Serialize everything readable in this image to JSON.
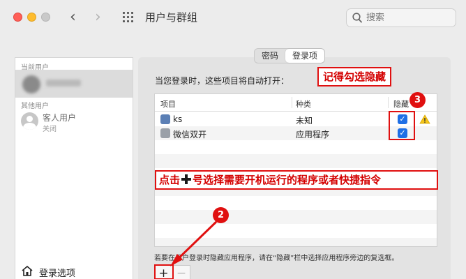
{
  "window": {
    "title": "用户与群组",
    "search_placeholder": "搜索"
  },
  "sidebar": {
    "current_user_section": "当前用户",
    "other_users_section": "其他用户",
    "guest": {
      "name": "客人用户",
      "status": "关闭"
    },
    "login_options": "登录选项"
  },
  "tabs": [
    {
      "label": "密码",
      "active": false
    },
    {
      "label": "登录项",
      "active": true
    }
  ],
  "login_items": {
    "instruction": "当您登录时，这些项目将自动打开：",
    "columns": {
      "item": "项目",
      "kind": "种类",
      "hide": "隐藏"
    },
    "rows": [
      {
        "name": "ks",
        "kind": "未知",
        "hidden": true,
        "icon": "app-icon-ks"
      },
      {
        "name": "微信双开",
        "kind": "应用程序",
        "hidden": true,
        "icon": "app-icon-wechat-dual"
      }
    ],
    "footer_note": "若要在用户登录时隐藏应用程序，请在“隐藏”栏中选择应用程序旁边的复选框。",
    "add_label": "+",
    "remove_label": "−"
  },
  "annotations": {
    "hide_tip": "记得勾选隐藏",
    "add_tip": "点击",
    "add_tip_rest": "号选择需要开机运行的程序或者快捷指令",
    "badge_hide": "3",
    "badge_add": "2"
  },
  "colors": {
    "accent": "#1f6fe5",
    "annotation_red": "#e01010",
    "warning": "#f5c518"
  }
}
